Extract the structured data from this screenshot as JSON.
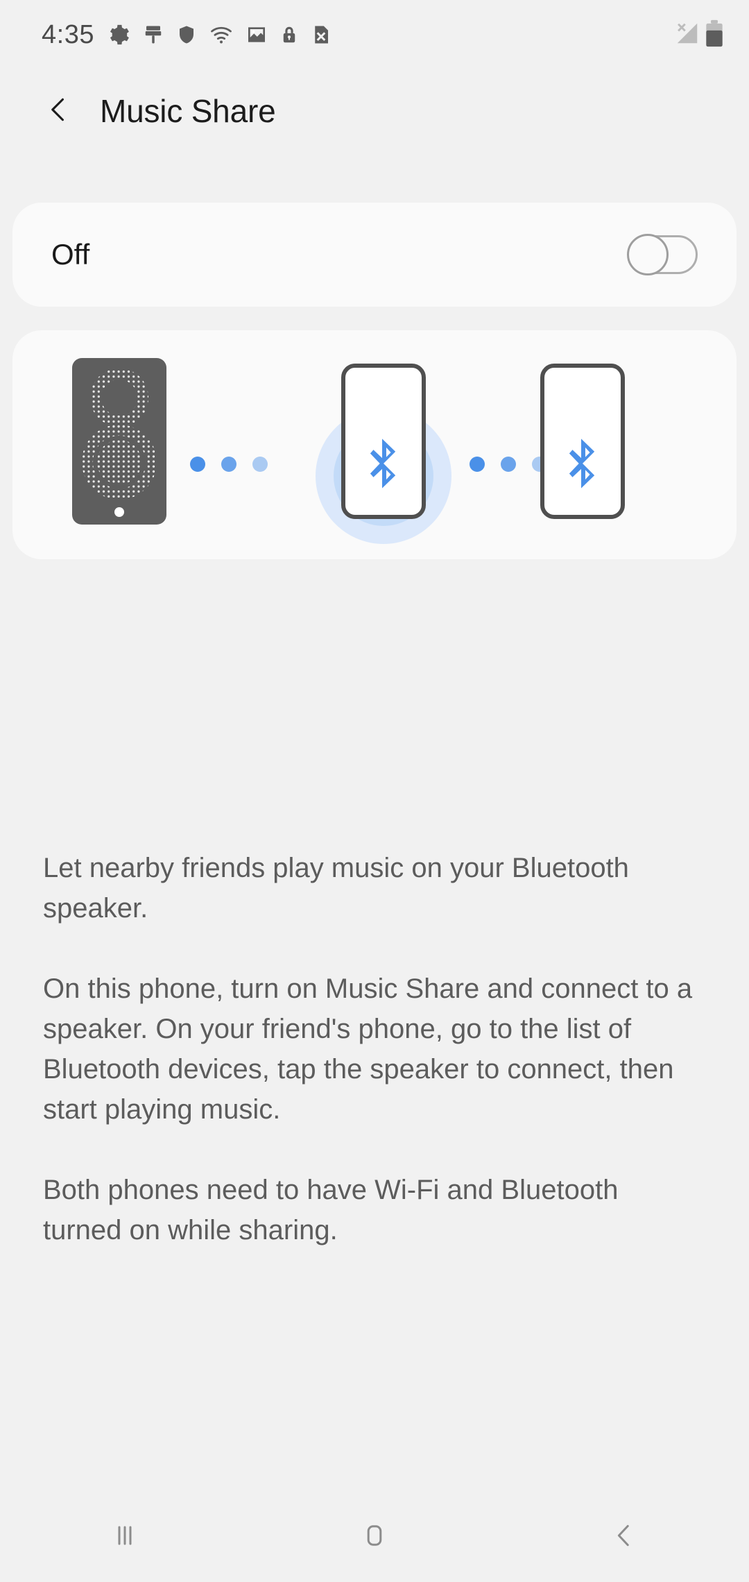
{
  "statusbar": {
    "time": "4:35",
    "icons": [
      {
        "name": "gear-icon",
        "label": "Settings"
      },
      {
        "name": "paintbrush-icon",
        "label": "Theme"
      },
      {
        "name": "shield-icon",
        "label": "Secure"
      },
      {
        "name": "wifi-icon",
        "label": "Wi-Fi"
      },
      {
        "name": "image-icon",
        "label": "Screenshot"
      },
      {
        "name": "lock-icon",
        "label": "Locked"
      },
      {
        "name": "sim-card-x-icon",
        "label": "No SIM"
      }
    ],
    "right_icons": [
      {
        "name": "no-signal-icon",
        "label": "No signal"
      },
      {
        "name": "battery-icon",
        "label": "Battery"
      }
    ],
    "battery_level_percent": 70
  },
  "header": {
    "back_label": "Back",
    "title": "Music Share"
  },
  "toggle_card": {
    "state_label": "Off",
    "switch_on": false,
    "switch_name": "music-share-toggle"
  },
  "illustration": {
    "name": "music-share-illustration",
    "speaker_label": "Bluetooth speaker",
    "phone_center_label": "Your phone",
    "phone_right_label": "Friend's phone",
    "bluetooth_glyph": "Bluetooth",
    "dot_groups": 2,
    "dots_per_group": 3
  },
  "description": {
    "paragraphs": [
      "Let nearby friends play music on your Bluetooth speaker.",
      "On this phone, turn on Music Share and connect to a speaker. On your friend's phone, go to the list of Bluetooth devices, tap the speaker to connect, then start playing music.",
      "Both phones need to have Wi-Fi and Bluetooth turned on while sharing."
    ]
  },
  "navbar": {
    "recents_label": "Recents",
    "home_label": "Home",
    "back_label": "Back"
  },
  "colors": {
    "background": "#f1f1f1",
    "card": "#fafafa",
    "title_text": "#1c1c1c",
    "body_text": "#5c5c5c",
    "status_icon": "#5d5d5d",
    "bluetooth_blue": "#4a90e8",
    "glow_outer": "#dbe8fb",
    "glow_inner": "#c3dbf8",
    "speaker_body": "#5e5e5e",
    "phone_outline": "#4f4f4f",
    "nav_icon": "#8c8c8c",
    "switch_track": "#aeaeae"
  }
}
